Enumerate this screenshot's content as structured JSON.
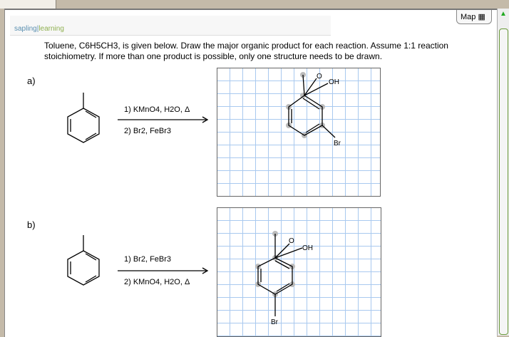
{
  "logo": {
    "brand_a": "sapling",
    "brand_b": "learning"
  },
  "map_button": "Map",
  "question": "Toluene, C6H5CH3, is given below. Draw the major organic product for each reaction. Assume 1:1 reaction stoichiometry. If more than one product is possible, only one structure needs to be drawn.",
  "parts": [
    {
      "label": "a)",
      "step1": "1) KMnO4, H2O, Δ",
      "step2": "2) Br2, FeBr3",
      "atoms": {
        "o": "O",
        "oh": "OH",
        "br": "Br"
      }
    },
    {
      "label": "b)",
      "step1": "1) Br2, FeBr3",
      "step2": "2) KMnO4, H2O, Δ",
      "atoms": {
        "o": "O",
        "oh": "OH",
        "br": "Br"
      }
    }
  ]
}
